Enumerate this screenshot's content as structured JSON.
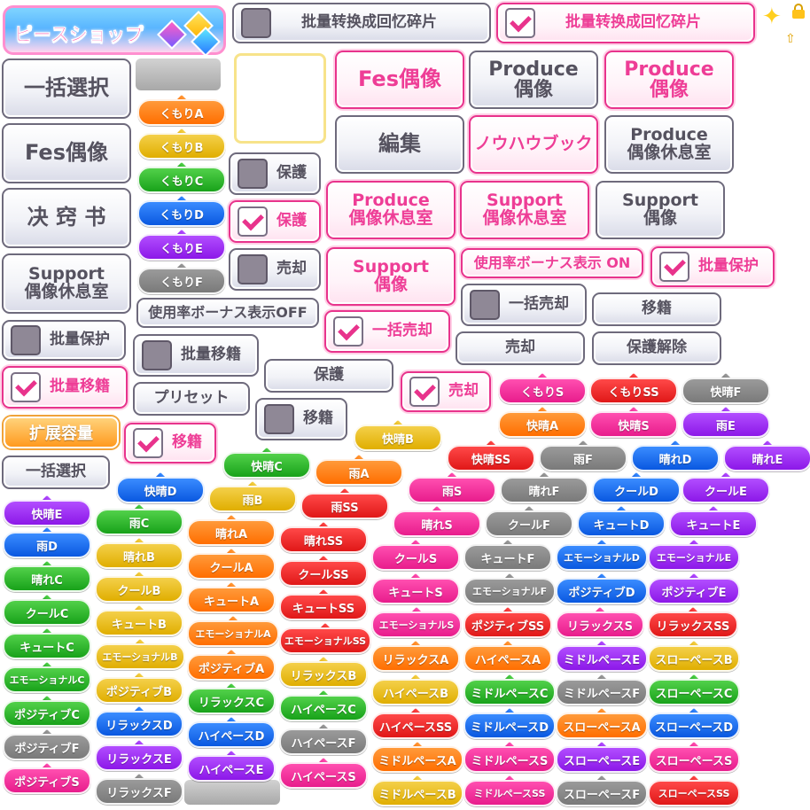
{
  "logo": {
    "text": "ピースショップ"
  },
  "top_toggles": {
    "convert_unchecked": "批量转换成回忆碎片",
    "convert_checked": "批量转换成回忆碎片"
  },
  "big_buttons": {
    "select_all_1": "一括選択",
    "fes_idol_gray": "Fes偶像",
    "decisive": "决 窍 书",
    "support_rest_gray_l1": "Support",
    "support_rest_gray_l2": "偶像休息室",
    "fes_idol_pink": "Fes偶像",
    "produce_idol_gray_l1": "Produce",
    "produce_idol_gray_l2": "偶像",
    "produce_idol_pink_l1": "Produce",
    "produce_idol_pink_l2": "偶像",
    "edit": "編集",
    "knowhow": "ノウハウブック",
    "produce_rest_gray_l1": "Produce",
    "produce_rest_gray_l2": "偶像休息室",
    "produce_rest_pink_l1": "Produce",
    "produce_rest_pink_l2": "偶像休息室",
    "support_rest_pink_l1": "Support",
    "support_rest_pink_l2": "偶像休息室",
    "support_idol_gray_l1": "Support",
    "support_idol_gray_l2": "偶像",
    "support_idol_pink_l1": "Support",
    "support_idol_pink_l2": "偶像"
  },
  "small_buttons": {
    "protect_off": "保護",
    "protect_on": "保護",
    "sell_off": "売却",
    "usage_bonus_on": "使用率ボーナス表示 ON",
    "usage_bonus_off": "使用率ボーナス表示OFF",
    "bulk_protect_on": "批量保护",
    "bulk_protect_off": "批量保护",
    "bulk_sell_on": "一括売却",
    "bulk_sell_off": "一括売却",
    "transfer": "移籍",
    "sell": "売却",
    "unprotect": "保護解除",
    "bulk_transfer_off": "批量移籍",
    "bulk_transfer_on": "批量移籍",
    "protect_plain": "保護",
    "sell_on": "売却",
    "preset": "プリセット",
    "transfer_off": "移籍",
    "transfer_on": "移籍",
    "expand_capacity": "扩展容量",
    "select_all_2": "一括選択"
  },
  "tags": [
    {
      "text": "くもりA",
      "color": "orange"
    },
    {
      "text": "くもりB",
      "color": "yellow"
    },
    {
      "text": "くもりC",
      "color": "green"
    },
    {
      "text": "くもりD",
      "color": "blue"
    },
    {
      "text": "くもりE",
      "color": "purple"
    },
    {
      "text": "くもりF",
      "color": "gray"
    },
    {
      "text": "くもりS",
      "color": "pink"
    },
    {
      "text": "くもりSS",
      "color": "red"
    },
    {
      "text": "快晴F",
      "color": "gray"
    },
    {
      "text": "快晴A",
      "color": "orange"
    },
    {
      "text": "快晴S",
      "color": "pink"
    },
    {
      "text": "雨E",
      "color": "purple"
    },
    {
      "text": "快晴B",
      "color": "yellow"
    },
    {
      "text": "快晴SS",
      "color": "red"
    },
    {
      "text": "雨F",
      "color": "gray"
    },
    {
      "text": "晴れD",
      "color": "blue"
    },
    {
      "text": "晴れE",
      "color": "purple"
    },
    {
      "text": "快晴C",
      "color": "green"
    },
    {
      "text": "雨A",
      "color": "orange"
    },
    {
      "text": "快晴D",
      "color": "blue"
    },
    {
      "text": "雨S",
      "color": "pink"
    },
    {
      "text": "晴れF",
      "color": "gray"
    },
    {
      "text": "クールD",
      "color": "blue"
    },
    {
      "text": "クールE",
      "color": "purple"
    },
    {
      "text": "雨B",
      "color": "yellow"
    },
    {
      "text": "雨SS",
      "color": "red"
    },
    {
      "text": "快晴E",
      "color": "purple"
    },
    {
      "text": "雨C",
      "color": "green"
    },
    {
      "text": "晴れS",
      "color": "pink"
    },
    {
      "text": "クールF",
      "color": "gray"
    },
    {
      "text": "キュートD",
      "color": "blue"
    },
    {
      "text": "キュートE",
      "color": "purple"
    },
    {
      "text": "晴れA",
      "color": "orange"
    },
    {
      "text": "晴れSS",
      "color": "red"
    },
    {
      "text": "雨D",
      "color": "blue"
    },
    {
      "text": "晴れB",
      "color": "yellow"
    },
    {
      "text": "クールA",
      "color": "orange"
    },
    {
      "text": "クールSS",
      "color": "red"
    },
    {
      "text": "クールS",
      "color": "pink"
    },
    {
      "text": "キュートF",
      "color": "gray"
    },
    {
      "text": "エモーショナルD",
      "color": "blue"
    },
    {
      "text": "エモーショナルE",
      "color": "purple"
    },
    {
      "text": "晴れC",
      "color": "green"
    },
    {
      "text": "クールB",
      "color": "yellow"
    },
    {
      "text": "キュートA",
      "color": "orange"
    },
    {
      "text": "キュートSS",
      "color": "red"
    },
    {
      "text": "キュートS",
      "color": "pink"
    },
    {
      "text": "エモーショナルF",
      "color": "gray"
    },
    {
      "text": "ポジティブD",
      "color": "blue"
    },
    {
      "text": "ポジティブE",
      "color": "purple"
    },
    {
      "text": "クールC",
      "color": "green"
    },
    {
      "text": "キュートB",
      "color": "yellow"
    },
    {
      "text": "エモーショナルA",
      "color": "orange"
    },
    {
      "text": "エモーショナルSS",
      "color": "red"
    },
    {
      "text": "エモーショナルS",
      "color": "pink"
    },
    {
      "text": "ポジティブSS",
      "color": "red"
    },
    {
      "text": "リラックスS",
      "color": "pink"
    },
    {
      "text": "リラックスSS",
      "color": "red"
    },
    {
      "text": "キュートC",
      "color": "green"
    },
    {
      "text": "エモーショナルB",
      "color": "yellow"
    },
    {
      "text": "ポジティブA",
      "color": "orange"
    },
    {
      "text": "リラックスB",
      "color": "yellow"
    },
    {
      "text": "リラックスA",
      "color": "orange"
    },
    {
      "text": "ハイペースA",
      "color": "orange"
    },
    {
      "text": "ミドルペースE",
      "color": "purple"
    },
    {
      "text": "スローペースB",
      "color": "yellow"
    },
    {
      "text": "エモーショナルC",
      "color": "green"
    },
    {
      "text": "ポジティブB",
      "color": "yellow"
    },
    {
      "text": "リラックスC",
      "color": "green"
    },
    {
      "text": "ハイペースC",
      "color": "green"
    },
    {
      "text": "ハイペースB",
      "color": "yellow"
    },
    {
      "text": "ミドルペースC",
      "color": "green"
    },
    {
      "text": "ミドルペースF",
      "color": "gray"
    },
    {
      "text": "スローペースC",
      "color": "green"
    },
    {
      "text": "ポジティブC",
      "color": "green"
    },
    {
      "text": "リラックスD",
      "color": "blue"
    },
    {
      "text": "ハイペースD",
      "color": "blue"
    },
    {
      "text": "ハイペースF",
      "color": "gray"
    },
    {
      "text": "ハイペースSS",
      "color": "red"
    },
    {
      "text": "ミドルペースD",
      "color": "blue"
    },
    {
      "text": "スローペースA",
      "color": "orange"
    },
    {
      "text": "スローペースD",
      "color": "blue"
    },
    {
      "text": "ポジティブF",
      "color": "gray"
    },
    {
      "text": "リラックスE",
      "color": "purple"
    },
    {
      "text": "ハイペースE",
      "color": "purple"
    },
    {
      "text": "ハイペースS",
      "color": "pink"
    },
    {
      "text": "ミドルペースA",
      "color": "orange"
    },
    {
      "text": "ミドルペースS",
      "color": "pink"
    },
    {
      "text": "スローペースE",
      "color": "purple"
    },
    {
      "text": "スローペースS",
      "color": "pink"
    },
    {
      "text": "ポジティブS",
      "color": "pink"
    },
    {
      "text": "リラックスF",
      "color": "gray"
    },
    {
      "text": "ミドルペースB",
      "color": "yellow"
    },
    {
      "text": "ミドルペースSS",
      "color": "pink"
    },
    {
      "text": "スローペースF",
      "color": "gray"
    },
    {
      "text": "スローペースSS",
      "color": "red"
    }
  ],
  "colors": {
    "pink_accent": "#e8338c",
    "gray_border": "#6e6a7c",
    "gray_text": "#55525f"
  },
  "icons": [
    "sparkle-icon",
    "lock-icon",
    "gem-icon",
    "check-icon"
  ]
}
